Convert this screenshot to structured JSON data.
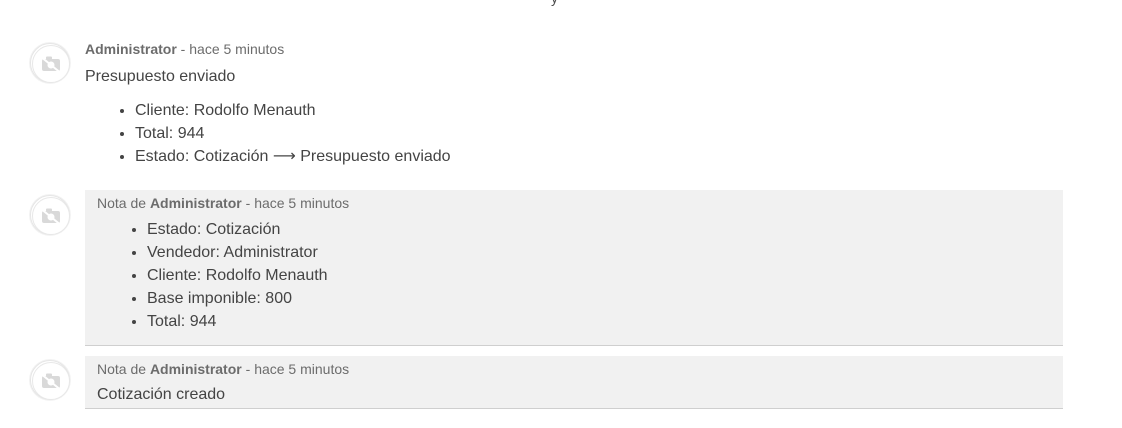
{
  "top_fragment": "y",
  "messages": [
    {
      "author": "Administrator",
      "time": "hace 5 minutos",
      "title": "Presupuesto enviado",
      "items": [
        "Cliente: Rodolfo Menauth",
        "Total: 944",
        "Estado: Cotización ⟶ Presupuesto enviado"
      ]
    },
    {
      "note_prefix": "Nota de",
      "author": "Administrator",
      "time": "hace 5 minutos",
      "items": [
        "Estado: Cotización",
        "Vendedor: Administrator",
        "Cliente: Rodolfo Menauth",
        "Base imponible: 800",
        "Total: 944"
      ]
    },
    {
      "note_prefix": "Nota de",
      "author": "Administrator",
      "time": "hace 5 minutos",
      "text": "Cotización creado"
    }
  ],
  "separator": " - ",
  "icons": {
    "avatar": "camera-placeholder-icon"
  }
}
